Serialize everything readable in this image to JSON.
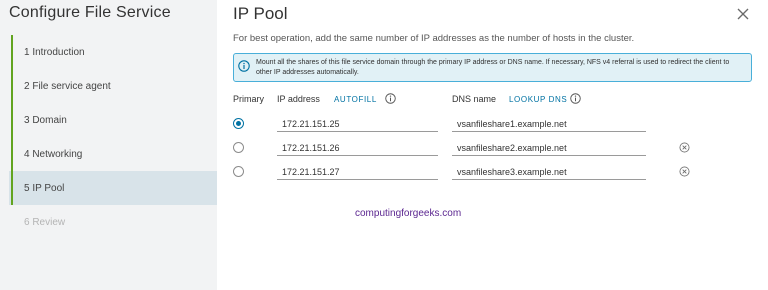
{
  "wizard": {
    "title": "Configure File Service",
    "steps": [
      {
        "label": "1 Introduction",
        "state": "completed"
      },
      {
        "label": "2 File service agent",
        "state": "completed"
      },
      {
        "label": "3 Domain",
        "state": "completed"
      },
      {
        "label": "4 Networking",
        "state": "completed"
      },
      {
        "label": "5 IP Pool",
        "state": "active"
      },
      {
        "label": "6 Review",
        "state": "disabled"
      }
    ]
  },
  "page": {
    "title": "IP Pool",
    "description": "For best operation, add the same number of IP addresses as the number of hosts in the cluster.",
    "alert_text": "Mount all the shares of this file service domain through the primary IP address or DNS name. If necessary, NFS v4 referral is used to redirect the client to other IP addresses automatically."
  },
  "table": {
    "headers": {
      "primary": "Primary",
      "ip_address": "IP address",
      "autofill": "AUTOFILL",
      "dns_name": "DNS name",
      "lookup_dns": "LOOKUP DNS"
    },
    "rows": [
      {
        "primary": true,
        "ip": "172.21.151.25",
        "dns": "vsanfileshare1.example.net"
      },
      {
        "primary": false,
        "ip": "172.21.151.26",
        "dns": "vsanfileshare2.example.net"
      },
      {
        "primary": false,
        "ip": "172.21.151.27",
        "dns": "vsanfileshare3.example.net"
      }
    ]
  },
  "watermark": "computingforgeeks.com",
  "colors": {
    "accent": "#0072a3",
    "completed": "#62a420",
    "alert_bg": "#e1f1f6",
    "alert_border": "#49afd9",
    "sidebar_bg": "#f2f3f4",
    "active_step_bg": "#d8e3e9"
  },
  "icons": {
    "close": "close-icon",
    "info": "info-circle-icon",
    "remove": "remove-circle-icon"
  }
}
